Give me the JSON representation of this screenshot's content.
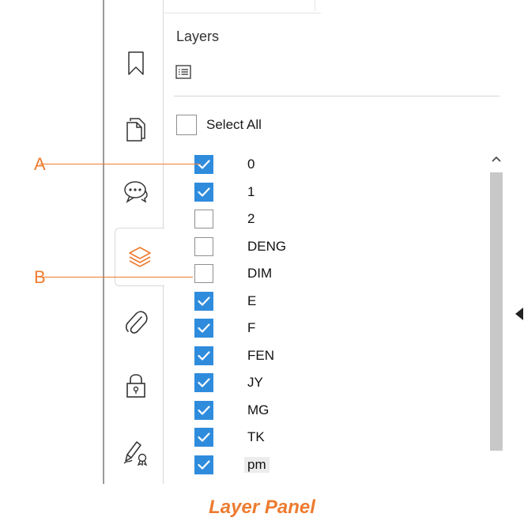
{
  "panel": {
    "title": "Layers",
    "select_all_label": "Select All",
    "select_all_checked": false
  },
  "toolbar": {
    "items": [
      {
        "name": "bookmark-icon",
        "active": false
      },
      {
        "name": "pages-icon",
        "active": false
      },
      {
        "name": "comments-icon",
        "active": false
      },
      {
        "name": "layers-icon",
        "active": true
      },
      {
        "name": "attachment-icon",
        "active": false
      },
      {
        "name": "lock-icon",
        "active": false
      },
      {
        "name": "signature-icon",
        "active": false
      }
    ]
  },
  "layers": [
    {
      "name": "0",
      "checked": true
    },
    {
      "name": "1",
      "checked": true
    },
    {
      "name": "2",
      "checked": false
    },
    {
      "name": "DENG",
      "checked": false
    },
    {
      "name": "DIM",
      "checked": false
    },
    {
      "name": "E",
      "checked": true
    },
    {
      "name": "F",
      "checked": true
    },
    {
      "name": "FEN",
      "checked": true
    },
    {
      "name": "JY",
      "checked": true
    },
    {
      "name": "MG",
      "checked": true
    },
    {
      "name": "TK",
      "checked": true
    },
    {
      "name": "pm",
      "checked": true
    }
  ],
  "callouts": {
    "a_label": "A",
    "b_label": "B"
  },
  "caption": "Layer Panel",
  "colors": {
    "accent": "#ee7b30",
    "checkbox_checked": "#2f8cdd",
    "icon_active": "#ee7b30",
    "icon": "#333333"
  }
}
